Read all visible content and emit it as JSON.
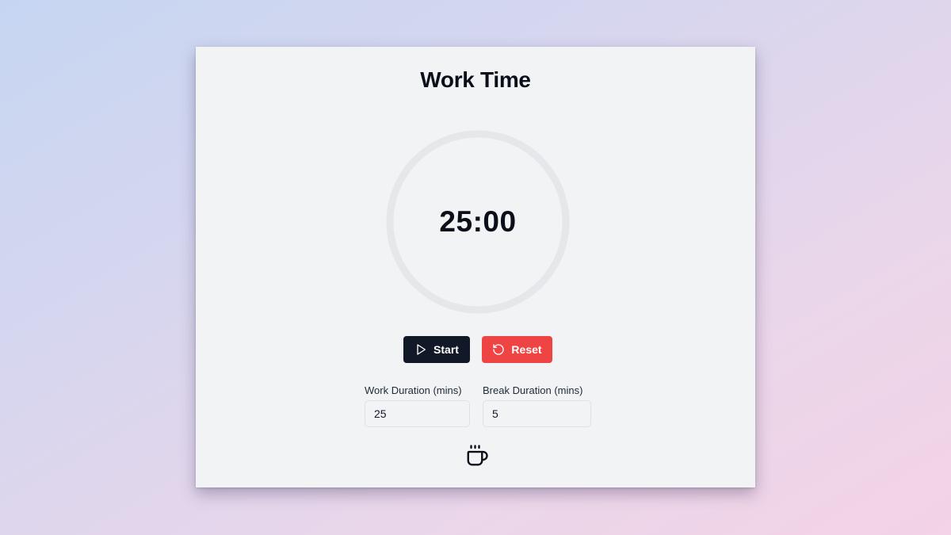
{
  "timer": {
    "title": "Work Time",
    "display": "25:00",
    "progress": 0
  },
  "controls": {
    "start_label": "Start",
    "reset_label": "Reset",
    "start_icon": "play-icon",
    "reset_icon": "rotate-ccw-icon"
  },
  "settings": {
    "work_label": "Work Duration (mins)",
    "work_value": "25",
    "break_label": "Break Duration (mins)",
    "break_value": "5"
  },
  "footer": {
    "icon": "coffee-icon"
  },
  "colors": {
    "start_button": "#111827",
    "reset_button": "#ef4444",
    "ring_track": "#e5e7eb",
    "card_background": "#f2f3f5"
  }
}
